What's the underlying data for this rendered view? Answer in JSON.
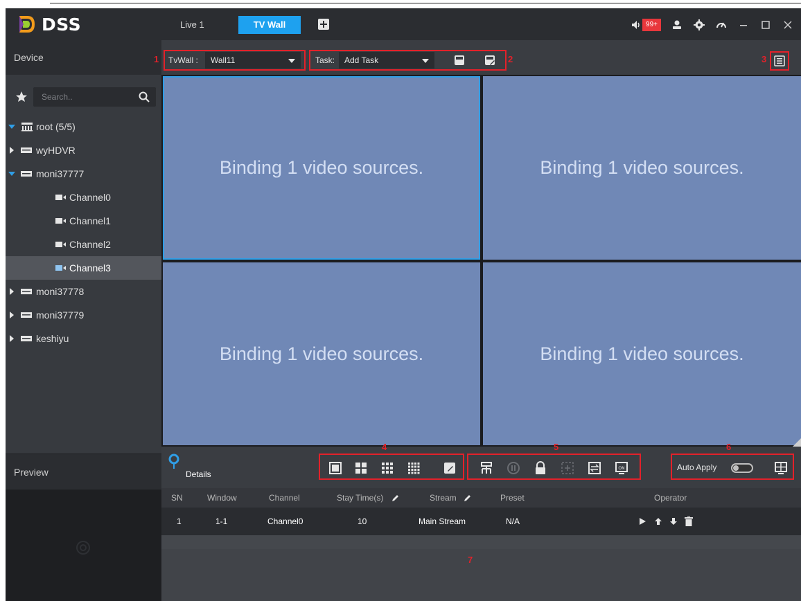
{
  "app": {
    "name": "DSS",
    "tabs": [
      {
        "label": "Live 1",
        "active": false
      },
      {
        "label": "TV Wall",
        "active": true
      }
    ],
    "notification_count": "99+",
    "accent_color": "#1ea1ef"
  },
  "sidebar": {
    "device_header": "Device",
    "search_placeholder": "Search..",
    "tree": [
      {
        "label": "root (5/5)",
        "level": 0,
        "expanded": true,
        "icon": "folder-tree-icon"
      },
      {
        "label": "wyHDVR",
        "level": 1,
        "expanded": false,
        "icon": "dvr-icon"
      },
      {
        "label": "moni37777",
        "level": 1,
        "expanded": true,
        "icon": "dvr-icon"
      },
      {
        "label": "Channel0",
        "level": 2,
        "icon": "camera-icon"
      },
      {
        "label": "Channel1",
        "level": 2,
        "icon": "camera-icon"
      },
      {
        "label": "Channel2",
        "level": 2,
        "icon": "camera-icon"
      },
      {
        "label": "Channel3",
        "level": 2,
        "icon": "camera-icon",
        "selected": true
      },
      {
        "label": "moni37778",
        "level": 1,
        "expanded": false,
        "icon": "dvr-icon"
      },
      {
        "label": "moni37779",
        "level": 1,
        "expanded": false,
        "icon": "dvr-icon"
      },
      {
        "label": "keshiyu",
        "level": 1,
        "expanded": false,
        "icon": "dvr-icon"
      }
    ],
    "preview_header": "Preview"
  },
  "toolbar": {
    "tvwall_label": "TvWall :",
    "tvwall_value": "Wall11",
    "task_label": "Task:",
    "task_value": "Add Task"
  },
  "annotations": [
    "1",
    "2",
    "3",
    "4",
    "5",
    "6",
    "7"
  ],
  "wall": {
    "cells": [
      {
        "text": "Binding 1 video sources."
      },
      {
        "text": "Binding 1 video sources."
      },
      {
        "text": "Binding 1 video sources."
      },
      {
        "text": "Binding 1 video sources."
      }
    ]
  },
  "controls": {
    "details_label": "Details",
    "auto_apply_label": "Auto Apply"
  },
  "table": {
    "headers": [
      "SN",
      "Window",
      "Channel",
      "Stay Time(s)",
      "Stream",
      "Preset",
      "Operator"
    ],
    "rows": [
      {
        "sn": "1",
        "window": "1-1",
        "channel": "Channel0",
        "stay": "10",
        "stream": "Main Stream",
        "preset": "N/A"
      }
    ]
  }
}
